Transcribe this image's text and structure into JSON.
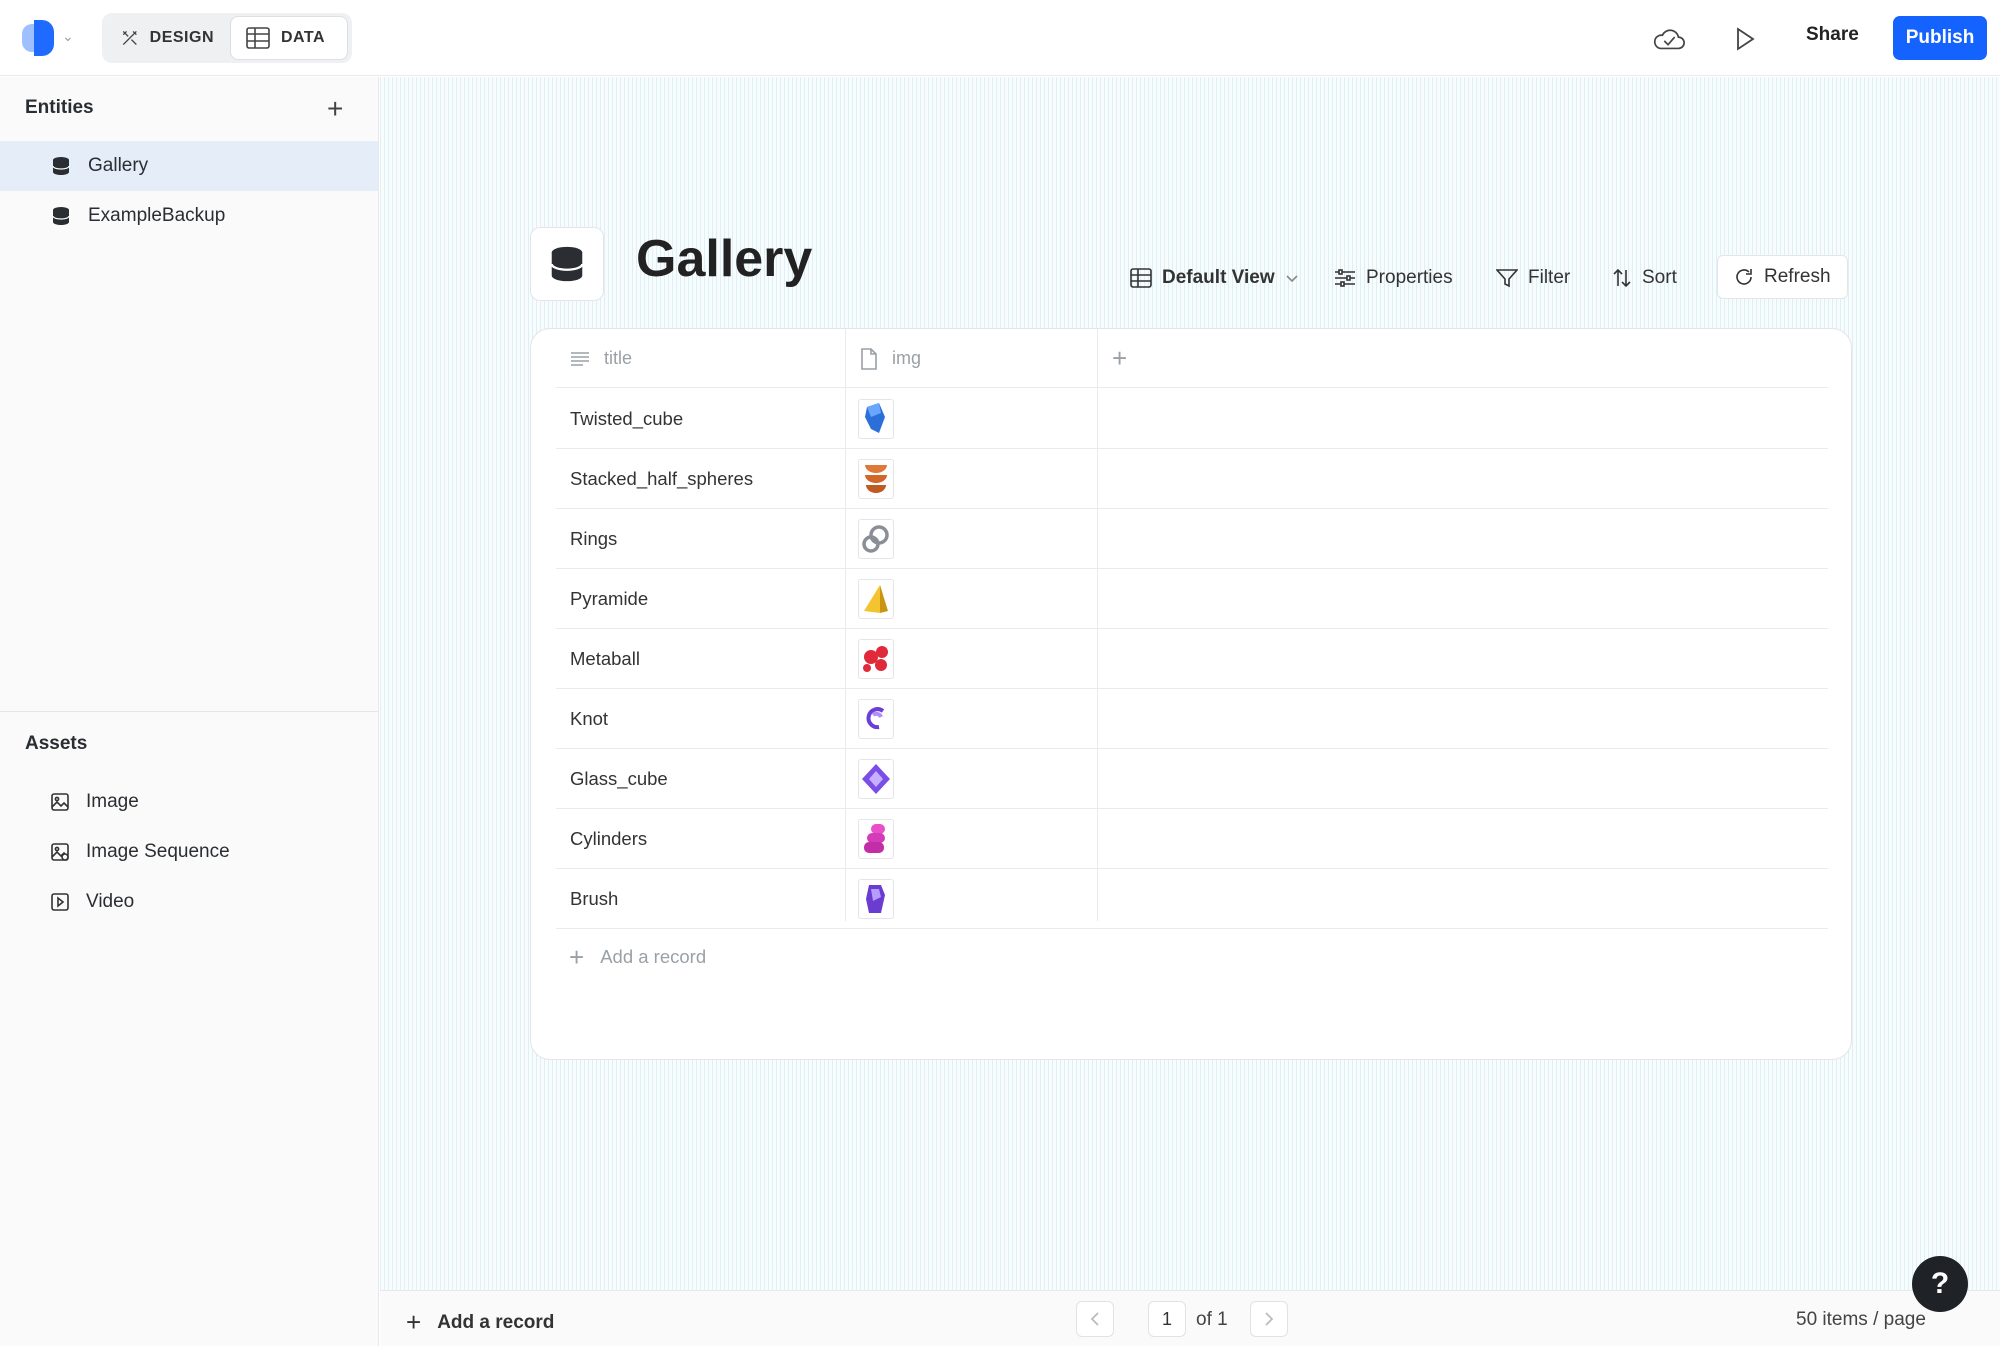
{
  "topbar": {
    "modes": {
      "design_label": "DESIGN",
      "data_label": "DATA"
    },
    "share_label": "Share",
    "publish_label": "Publish",
    "icons": [
      "cloud-check-icon",
      "play-icon"
    ],
    "accent_color": "#1463ff"
  },
  "sidebar": {
    "entities_title": "Entities",
    "entities": [
      {
        "label": "Gallery",
        "active": true
      },
      {
        "label": "ExampleBackup",
        "active": false
      }
    ],
    "assets_title": "Assets",
    "assets": [
      {
        "label": "Image",
        "icon": "image-icon"
      },
      {
        "label": "Image Sequence",
        "icon": "image-sequence-icon"
      },
      {
        "label": "Video",
        "icon": "video-icon"
      }
    ]
  },
  "main": {
    "title": "Gallery",
    "toolbar": {
      "view_label": "Default View",
      "properties_label": "Properties",
      "filter_label": "Filter",
      "sort_label": "Sort",
      "refresh_label": "Refresh"
    },
    "table": {
      "columns": [
        "title",
        "img"
      ],
      "rows": [
        {
          "title": "Twisted_cube",
          "img": "blue-twisted-cube-thumbnail"
        },
        {
          "title": "Stacked_half_spheres",
          "img": "orange-stacked-spheres-thumbnail"
        },
        {
          "title": "Rings",
          "img": "silver-rings-thumbnail"
        },
        {
          "title": "Pyramide",
          "img": "yellow-pyramid-thumbnail"
        },
        {
          "title": "Metaball",
          "img": "red-metaball-thumbnail"
        },
        {
          "title": "Knot",
          "img": "purple-knot-thumbnail"
        },
        {
          "title": "Glass_cube",
          "img": "violet-glass-cube-thumbnail"
        },
        {
          "title": "Cylinders",
          "img": "pink-cylinders-thumbnail"
        },
        {
          "title": "Brush",
          "img": "purple-brush-thumbnail"
        }
      ],
      "add_record_label": "Add a record"
    }
  },
  "footer": {
    "add_record_label": "Add a record",
    "page": "1",
    "of_label": "of 1",
    "per_page_label": "50 items / page"
  },
  "help_label": "?"
}
